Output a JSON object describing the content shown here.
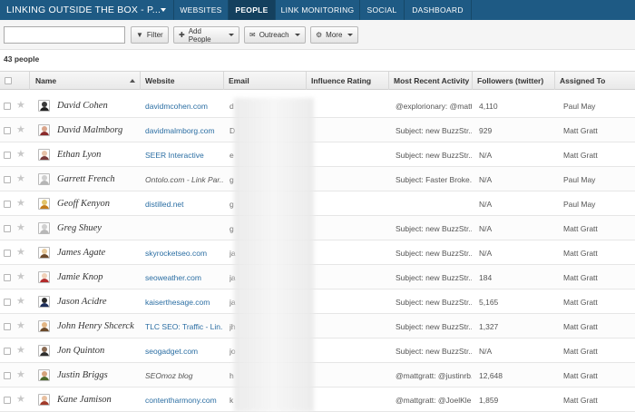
{
  "app": {
    "project_title": "LINKING OUTSIDE THE BOX - P...",
    "nav_tabs": [
      {
        "label": "WEBSITES",
        "active": false
      },
      {
        "label": "PEOPLE",
        "active": true
      },
      {
        "label": "LINK MONITORING",
        "active": false
      },
      {
        "label": "SOCIAL",
        "active": false
      },
      {
        "label": "DASHBOARD",
        "active": false
      }
    ],
    "brand_color": "#1e5a84"
  },
  "toolbar": {
    "search_value": "",
    "filter_label": "Filter",
    "add_people_label": "Add People",
    "outreach_label": "Outreach",
    "more_label": "More"
  },
  "people_count": "43 people",
  "columns": {
    "name": "Name",
    "website": "Website",
    "email": "Email",
    "influence": "Influence Rating",
    "activity": "Most Recent Activity",
    "followers": "Followers (twitter)",
    "assigned": "Assigned To"
  },
  "rows": [
    {
      "name": "David Cohen",
      "website": "davidmcohen.com",
      "website_link": true,
      "email": "d",
      "influence": "",
      "activity": "@explorionary: @matt...",
      "followers": "4,110",
      "assigned": "Paul May"
    },
    {
      "name": "David Malmborg",
      "website": "davidmalmborg.com",
      "website_link": true,
      "email": "D",
      "influence": "",
      "activity": "Subject: new BuzzStr...",
      "followers": "929",
      "assigned": "Matt Gratt"
    },
    {
      "name": "Ethan Lyon",
      "website": "SEER Interactive",
      "website_link": true,
      "email": "e",
      "influence": "",
      "activity": "Subject: new BuzzStr...",
      "followers": "N/A",
      "assigned": "Matt Gratt"
    },
    {
      "name": "Garrett French",
      "website": "Ontolo.com - Link Par...",
      "website_link": false,
      "email": "g",
      "influence": "",
      "activity": "Subject: Faster Broke...",
      "followers": "N/A",
      "assigned": "Paul May"
    },
    {
      "name": "Geoff Kenyon",
      "website": "distilled.net",
      "website_link": true,
      "email": "g",
      "influence": "",
      "activity": "",
      "followers": "N/A",
      "assigned": "Paul May"
    },
    {
      "name": "Greg Shuey",
      "website": "",
      "website_link": true,
      "email": "g",
      "influence": "",
      "activity": "Subject: new BuzzStr...",
      "followers": "N/A",
      "assigned": "Matt Gratt"
    },
    {
      "name": "James Agate",
      "website": "skyrocketseo.com",
      "website_link": true,
      "email": "ja",
      "influence": "",
      "activity": "Subject: new BuzzStr...",
      "followers": "N/A",
      "assigned": "Matt Gratt"
    },
    {
      "name": "Jamie Knop",
      "website": "seoweather.com",
      "website_link": true,
      "email": "ja",
      "influence": "",
      "activity": "Subject: new BuzzStr...",
      "followers": "184",
      "assigned": "Matt Gratt"
    },
    {
      "name": "Jason Acidre",
      "website": "kaiserthesage.com",
      "website_link": true,
      "email": "ja",
      "influence": "",
      "activity": "Subject: new BuzzStr...",
      "followers": "5,165",
      "assigned": "Matt Gratt"
    },
    {
      "name": "John Henry Shcerck",
      "website": "TLC SEO: Traffic - Lin...",
      "website_link": true,
      "email": "jh",
      "influence": "",
      "activity": "Subject: new BuzzStr...",
      "followers": "1,327",
      "assigned": "Matt Gratt"
    },
    {
      "name": "Jon Quinton",
      "website": "seogadget.com",
      "website_link": true,
      "email": "jo",
      "influence": "",
      "activity": "Subject: new BuzzStr...",
      "followers": "N/A",
      "assigned": "Matt Gratt"
    },
    {
      "name": "Justin Briggs",
      "website": "SEOmoz blog",
      "website_link": false,
      "email": "h",
      "influence": "",
      "activity": "@mattgratt: @justinrb...",
      "followers": "12,648",
      "assigned": "Matt Gratt"
    },
    {
      "name": "Kane Jamison",
      "website": "contentharmony.com",
      "website_link": true,
      "email": "k",
      "influence": "",
      "activity": "@mattgratt: @JoelKle...",
      "followers": "1,859",
      "assigned": "Matt Gratt"
    }
  ]
}
